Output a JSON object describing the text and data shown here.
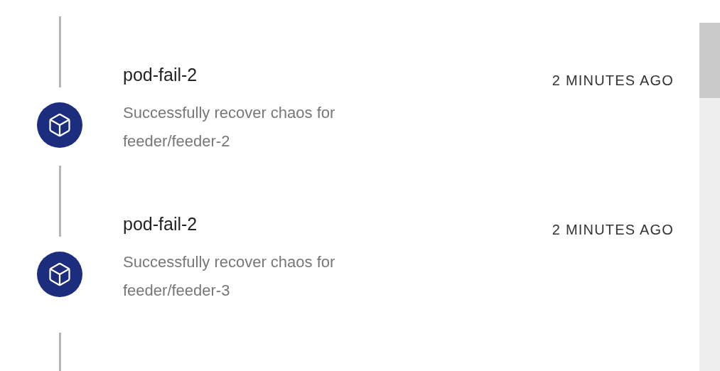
{
  "events": [
    {
      "title": "pod-fail-2",
      "description": "Successfully recover chaos for feeder/feeder-2",
      "time": "2 MINUTES AGO"
    },
    {
      "title": "pod-fail-2",
      "description": "Successfully recover chaos for feeder/feeder-3",
      "time": "2 MINUTES AGO"
    }
  ]
}
